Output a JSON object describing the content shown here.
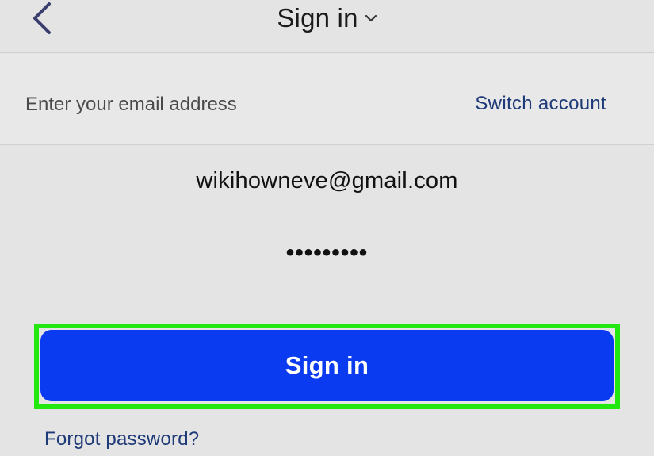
{
  "header": {
    "title": "Sign in",
    "back_icon": "chevron-left-icon",
    "dropdown_icon": "chevron-down-icon"
  },
  "prompt": {
    "text": "Enter your email address",
    "switch_account": "Switch account"
  },
  "email": {
    "value": "wikihowneve@gmail.com"
  },
  "password": {
    "value": "•••••••••"
  },
  "actions": {
    "sign_in": "Sign in",
    "forgot_password": "Forgot password?"
  },
  "colors": {
    "background": "#e4e4e4",
    "primary_button": "#0a3bf0",
    "link": "#1e3a78",
    "highlight": "#22e80f"
  }
}
